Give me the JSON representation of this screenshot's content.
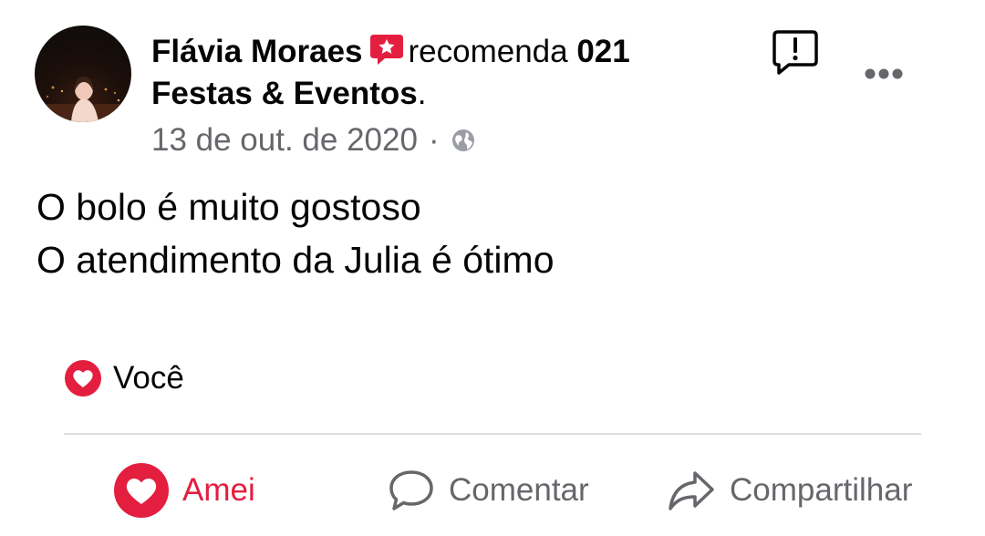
{
  "post": {
    "author": "Flávia Moraes",
    "action": "recomenda",
    "page": "021 Festas & Eventos",
    "page_suffix": ".",
    "date": "13 de out. de 2020",
    "separator": "·",
    "privacy_icon": "globe-icon",
    "body_lines": [
      "O bolo é muito gostoso",
      "O atendimento da Julia é ótimo"
    ]
  },
  "reactions": {
    "icon": "love-icon",
    "label": "Você"
  },
  "actions": {
    "love_label": "Amei",
    "comment_label": "Comentar",
    "share_label": "Compartilhar"
  },
  "colors": {
    "love_red": "#e41e3f",
    "muted_text": "#65676b",
    "divider": "#dcdde1"
  }
}
